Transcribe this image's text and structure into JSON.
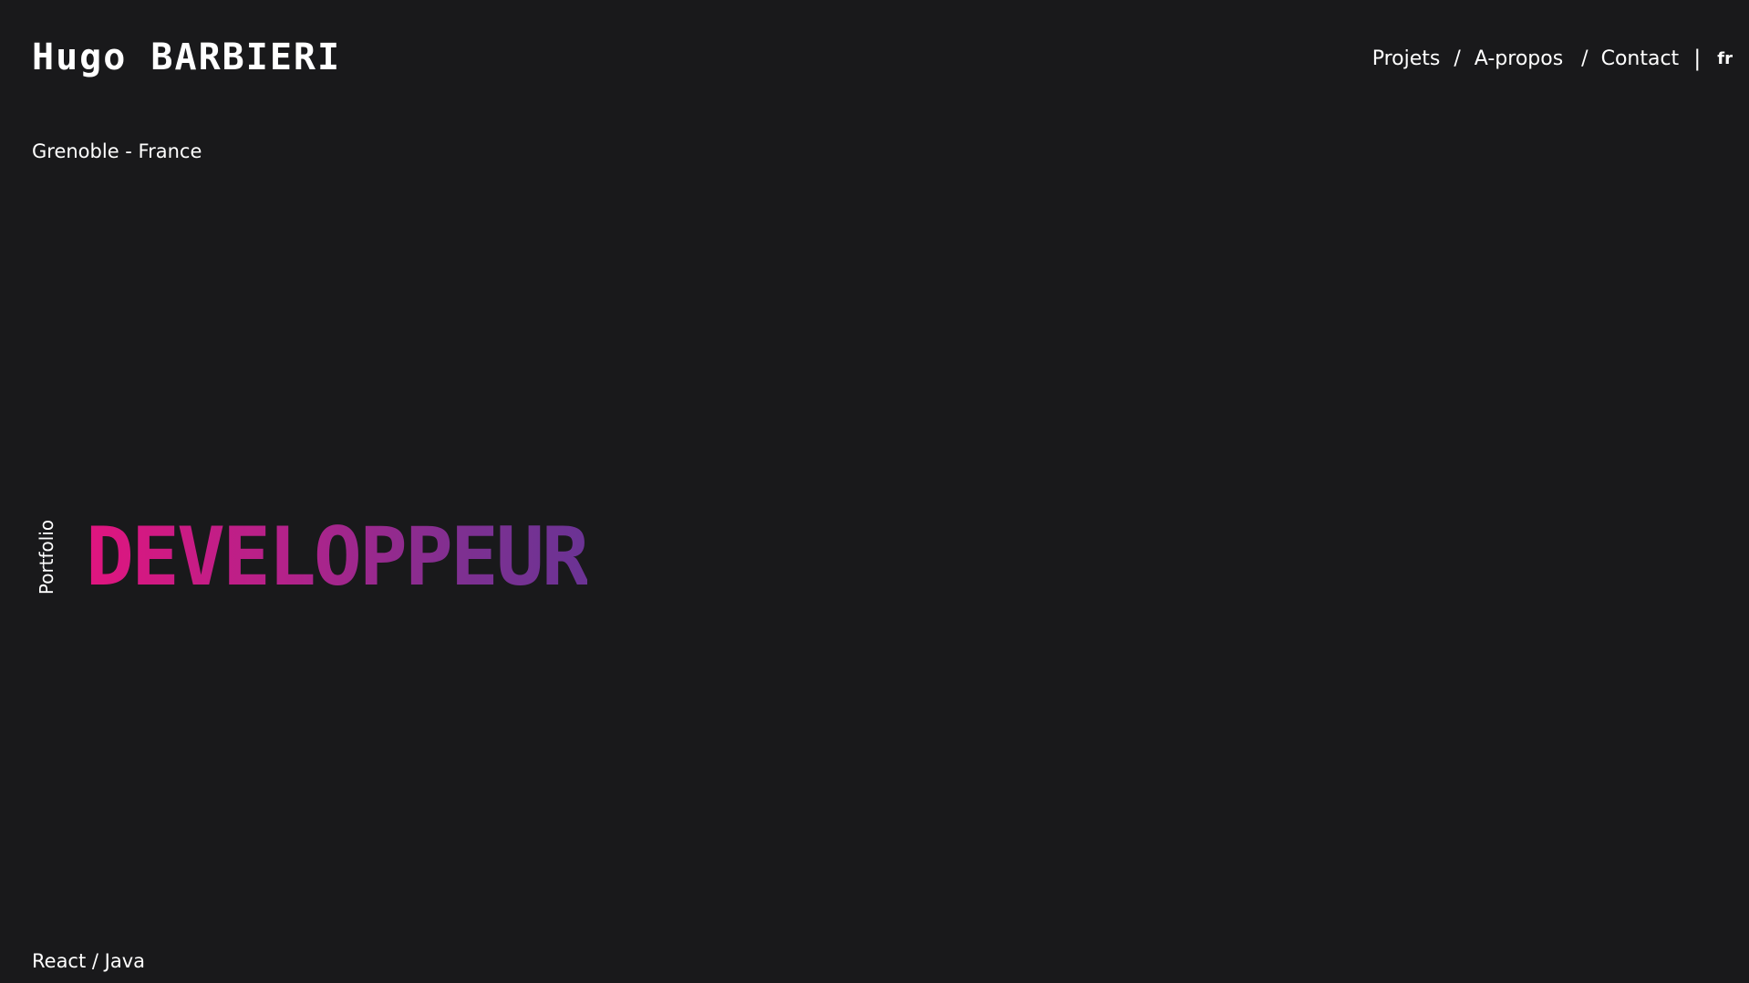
{
  "header": {
    "brand": "Hugo BARBIERI",
    "nav": {
      "projets": "Projets",
      "sep1": "/",
      "apropos": "A-propos",
      "sep2": "/",
      "contact": "Contact",
      "pipe": "|",
      "lang": "fr"
    }
  },
  "intro": {
    "location": "Grenoble - France",
    "side_label": "Portfolio",
    "hero_title": "DEVELOPPEUR",
    "stack": "React / Java"
  },
  "colors": {
    "background": "#19191b",
    "text": "#ffffff",
    "gradient_start": "#e0157f",
    "gradient_end": "#6b3394"
  }
}
